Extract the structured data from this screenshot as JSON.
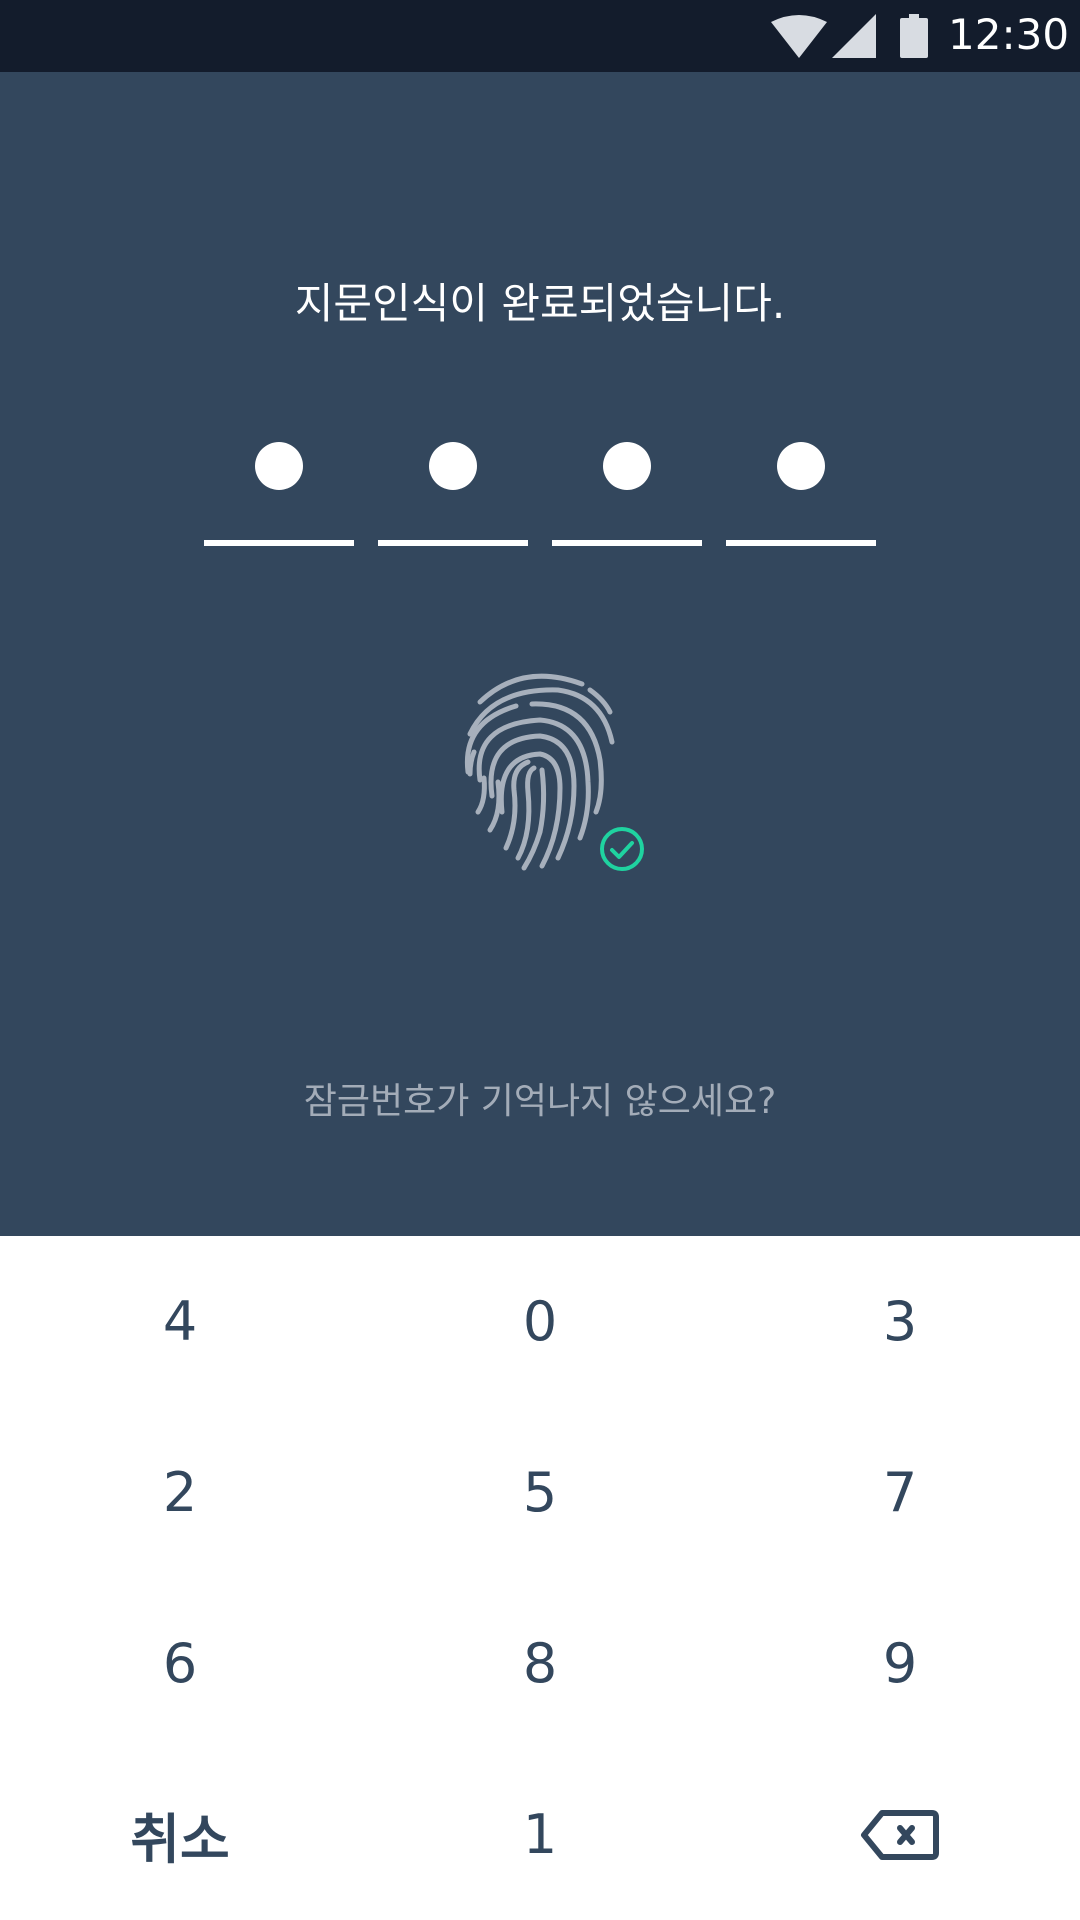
{
  "status_bar": {
    "time": "12:30",
    "icons": [
      "wifi-icon",
      "signal-icon",
      "battery-icon"
    ]
  },
  "lock_screen": {
    "title": "지문인식이 완료되었습니다.",
    "pin_filled": 4,
    "pin_length": 4,
    "fingerprint_icon": "fingerprint-icon",
    "status_icon": "check-circle-icon",
    "forgot_link": "잠금번호가 기억나지 않으세요?"
  },
  "keypad": {
    "keys": [
      {
        "label": "4"
      },
      {
        "label": "0"
      },
      {
        "label": "3"
      },
      {
        "label": "2"
      },
      {
        "label": "5"
      },
      {
        "label": "7"
      },
      {
        "label": "6"
      },
      {
        "label": "8"
      },
      {
        "label": "9"
      },
      {
        "label": "취소"
      },
      {
        "label": "1"
      },
      {
        "label": "",
        "icon": "backspace-icon"
      }
    ]
  },
  "colors": {
    "status_bar_bg": "#131c2c",
    "panel_bg": "#33475d",
    "keypad_bg": "#ffffff",
    "key_text": "#33475d",
    "accent_green": "#1fd3a0",
    "forgot_text": "#a3acb8"
  }
}
